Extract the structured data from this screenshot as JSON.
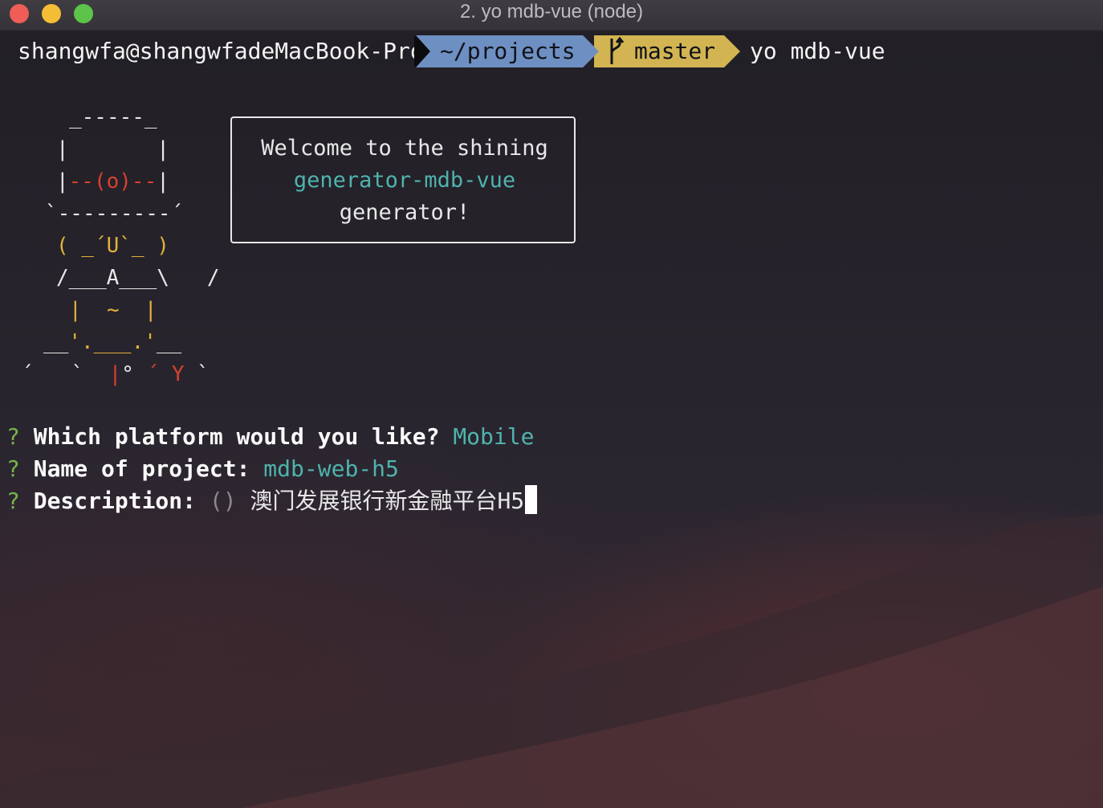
{
  "window": {
    "title": "2. yo mdb-vue (node)"
  },
  "prompt": {
    "user_host": "shangwfa@shangwfadeMacBook-Pro",
    "directory": "~/projects",
    "branch_icon": "git-branch-icon",
    "branch": "master",
    "command": "yo mdb-vue"
  },
  "art": {
    "line1": "_-----_",
    "line2": "|       |",
    "line3_left": "|",
    "line3_mid": "--(o)--",
    "line3_right": "|",
    "line4": "`---------´",
    "line5": "( _´U`_ )",
    "line6": "/___A___\\   /",
    "line7": "|  ~  |",
    "line8_a": "__",
    "line8_b": "'.___.'",
    "line8_c": "__",
    "line9_a": "´   `  ",
    "line9_b": "|",
    "line9_c": "° ",
    "line9_d": "´ Y",
    "line9_e": " `"
  },
  "welcome": {
    "line1": "Welcome to the shining",
    "line2": "generator-mdb-vue",
    "line3": "generator!"
  },
  "questions": [
    {
      "mark": "?",
      "text": "Which platform would you like?",
      "answer": "Mobile"
    },
    {
      "mark": "?",
      "text": "Name of project:",
      "answer": "mdb-web-h5"
    },
    {
      "mark": "?",
      "text": "Description:",
      "hint": "()",
      "answer": "澳门发展银行新金融平台H5"
    }
  ],
  "colors": {
    "dir_segment": "#6e8fc2",
    "git_segment": "#d2b452",
    "answer": "#4fb3ad",
    "question_mark": "#78b34a"
  }
}
